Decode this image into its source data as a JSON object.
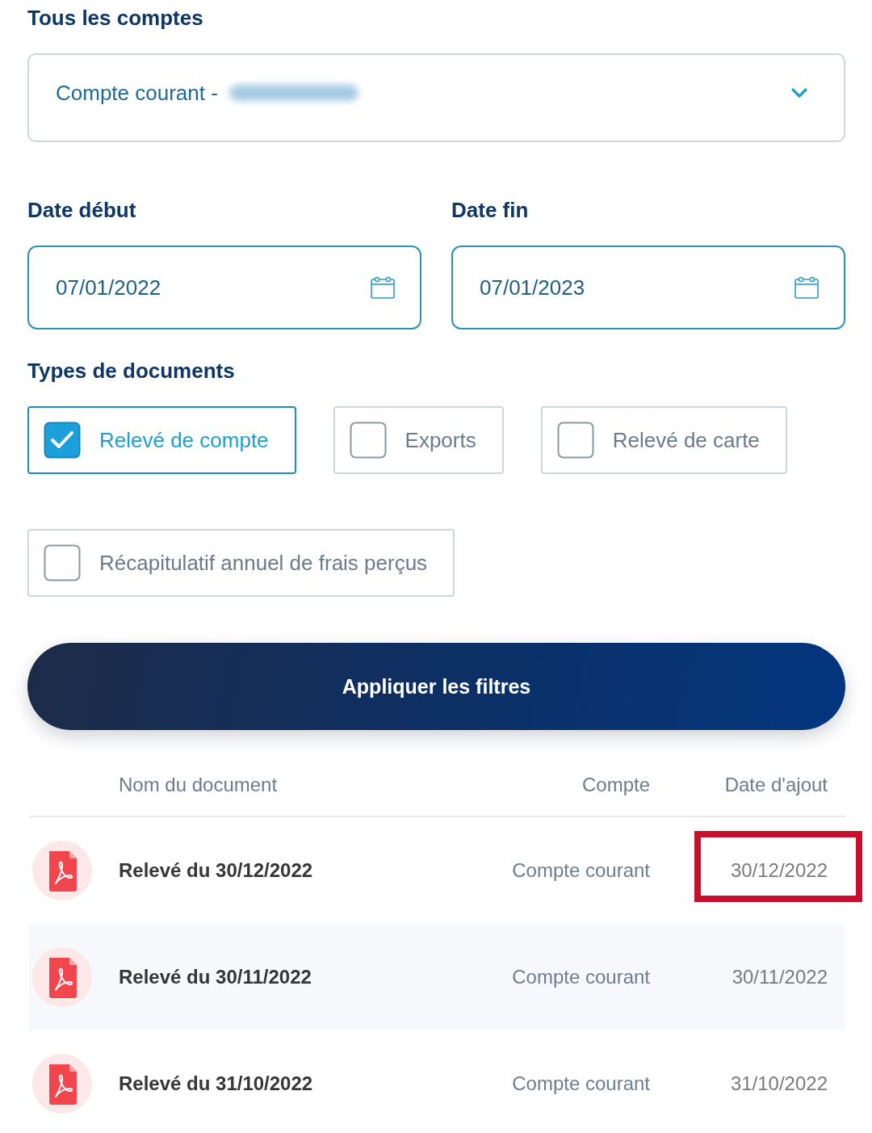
{
  "account_filter": {
    "label": "Tous les comptes",
    "value": "Compte courant -",
    "redacted": true
  },
  "date_range": [
    {
      "label": "Date début",
      "value": "07/01/2022"
    },
    {
      "label": "Date fin",
      "value": "07/01/2023"
    }
  ],
  "document_types": {
    "label": "Types de documents",
    "options": [
      {
        "label": "Relevé de compte",
        "checked": true
      },
      {
        "label": "Exports",
        "checked": false
      },
      {
        "label": "Relevé de carte",
        "checked": false
      },
      {
        "label": "Récapitulatif annuel de frais perçus",
        "checked": false
      }
    ]
  },
  "apply_button": {
    "label": "Appliquer les filtres"
  },
  "table": {
    "columns": [
      "Nom du document",
      "Compte",
      "Date d'ajout"
    ],
    "rows": [
      {
        "name": "Relevé du 30/12/2022",
        "account": "Compte courant",
        "date": "30/12/2022",
        "highlighted": true
      },
      {
        "name": "Relevé du 30/11/2022",
        "account": "Compte courant",
        "date": "30/11/2022",
        "highlighted": false
      },
      {
        "name": "Relevé du 31/10/2022",
        "account": "Compte courant",
        "date": "31/10/2022",
        "highlighted": false
      }
    ]
  }
}
